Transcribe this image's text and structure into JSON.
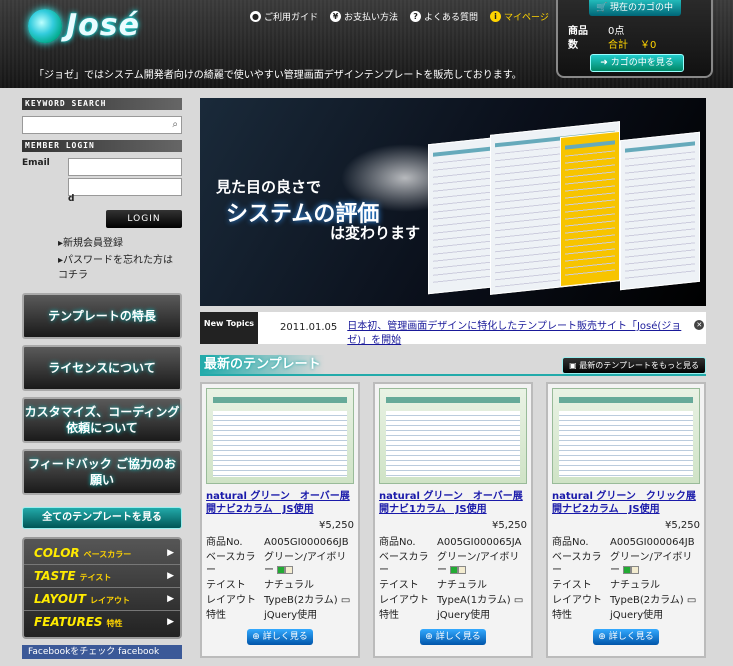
{
  "header": {
    "logo": "José",
    "tagline": "「ジョゼ」ではシステム開発者向けの綺麗で使いやすい管理画面デザインテンプレートを販売しております。",
    "nav": [
      {
        "label": "ご利用ガイド",
        "icon": "guide-icon"
      },
      {
        "label": "お支払い方法",
        "icon": "yen-icon"
      },
      {
        "label": "よくある質問",
        "icon": "question-icon"
      },
      {
        "label": "マイページ",
        "icon": "info-icon"
      }
    ]
  },
  "cart": {
    "title": "現在のカゴの中",
    "items_label": "商品",
    "items_value": "0点",
    "qty_label": "数",
    "total_label": "合計",
    "total_value": "￥0",
    "button": "カゴの中を見る"
  },
  "sidebar": {
    "search_title": "KEYWORD SEARCH",
    "login_title": "MEMBER LOGIN",
    "email_label": "Email",
    "password_label": "d",
    "login_button": "LOGIN",
    "links": [
      "新規会員登録",
      "パスワードを忘れた方はコチラ"
    ],
    "big_buttons": [
      "テンプレートの特長",
      "ライセンスについて",
      "カスタマイズ、コーディング依頼について",
      "フィードバック ご協力のお願い"
    ],
    "all_templates": "全てのテンプレートを見る",
    "categories": [
      {
        "en": "COLOR",
        "jp": "ベースカラー"
      },
      {
        "en": "TASTE",
        "jp": "テイスト"
      },
      {
        "en": "LAYOUT",
        "jp": "レイアウト"
      },
      {
        "en": "FEATURES",
        "jp": "特性"
      }
    ],
    "facebook": "Facebookをチェック facebook"
  },
  "hero": {
    "line1": "見た目の良さで",
    "line2": "システムの評価",
    "line3": "は変わります"
  },
  "news": {
    "tag": "New Topics",
    "date": "2011.01.05",
    "text": "日本初、管理画面デザインに特化したテンプレート販売サイト「José(ジョゼ)」を開始"
  },
  "latest": {
    "title": "最新のテンプレート",
    "more": "最新のテンプレートをもっと見る"
  },
  "spec_labels": {
    "product_no": "商品No.",
    "base_color": "ベースカラー",
    "taste": "テイスト",
    "layout": "レイアウト",
    "feature": "特性"
  },
  "detail_button": "詳しく見る",
  "products": [
    {
      "title": "natural グリーン　オーバー展開ナビ2カラム　JS使用",
      "price": "¥5,250",
      "no": "A005GI000066JB",
      "color": "グリーン/アイボリー",
      "taste": "ナチュラル",
      "layout": "TypeB(2カラム)",
      "feature": "jQuery使用"
    },
    {
      "title": "natural グリーン　オーバー展開ナビ1カラム　JS使用",
      "price": "¥5,250",
      "no": "A005GI000065JA",
      "color": "グリーン/アイボリー",
      "taste": "ナチュラル",
      "layout": "TypeA(1カラム)",
      "feature": "jQuery使用"
    },
    {
      "title": "natural グリーン　クリック展開ナビ2カラム　JS使用",
      "price": "¥5,250",
      "no": "A005GI000064JB",
      "color": "グリーン/アイボリー",
      "taste": "ナチュラル",
      "layout": "TypeB(2カラム)",
      "feature": "jQuery使用"
    }
  ],
  "colors": {
    "accent": "#22aaaa",
    "swatch_green": "#2a3",
    "swatch_ivory": "#f3ecd0"
  }
}
